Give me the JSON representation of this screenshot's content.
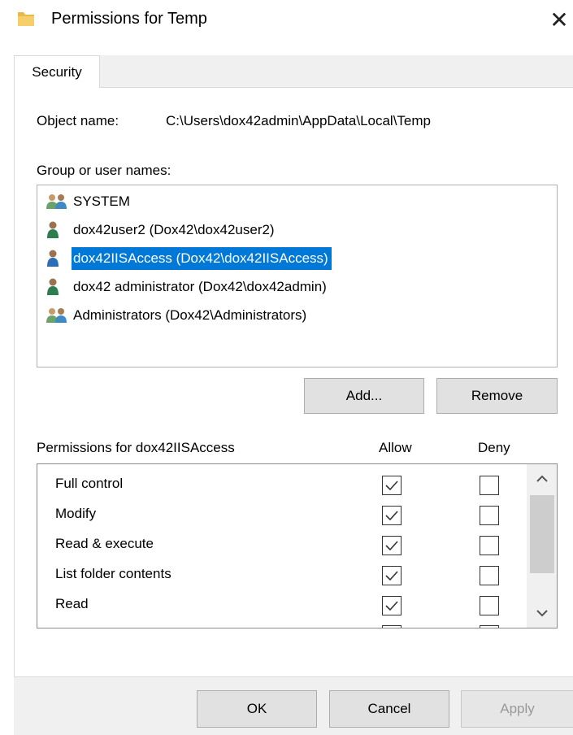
{
  "window": {
    "title": "Permissions for Temp",
    "close_glyph": "✕",
    "folder_icon": "folder-icon"
  },
  "tabs": [
    {
      "label": "Security",
      "selected": true
    }
  ],
  "object": {
    "label": "Object name:",
    "value": "C:\\Users\\dox42admin\\AppData\\Local\\Temp"
  },
  "groups": {
    "label": "Group or user names:",
    "items": [
      {
        "label": "SYSTEM",
        "icon": "user-group-icon",
        "selected": false
      },
      {
        "label": "dox42user2 (Dox42\\dox42user2)",
        "icon": "user-icon",
        "selected": false
      },
      {
        "label": "dox42IISAccess (Dox42\\dox42IISAccess)",
        "icon": "user-icon",
        "selected": true
      },
      {
        "label": "dox42 administrator (Dox42\\dox42admin)",
        "icon": "user-icon",
        "selected": false
      },
      {
        "label": "Administrators (Dox42\\Administrators)",
        "icon": "user-group-icon",
        "selected": false
      }
    ],
    "add_label": "Add...",
    "remove_label": "Remove"
  },
  "permissions": {
    "label": "Permissions for dox42IISAccess",
    "allow_header": "Allow",
    "deny_header": "Deny",
    "rows": [
      {
        "name": "Full control",
        "allow": true,
        "deny": false
      },
      {
        "name": "Modify",
        "allow": true,
        "deny": false
      },
      {
        "name": "Read & execute",
        "allow": true,
        "deny": false
      },
      {
        "name": "List folder contents",
        "allow": true,
        "deny": false
      },
      {
        "name": "Read",
        "allow": true,
        "deny": false
      }
    ]
  },
  "footer": {
    "ok_label": "OK",
    "cancel_label": "Cancel",
    "apply_label": "Apply",
    "apply_enabled": false
  },
  "colors": {
    "selection": "#0078d7",
    "dialog_bg": "#f0f0f0",
    "button_bg": "#e1e1e1"
  }
}
